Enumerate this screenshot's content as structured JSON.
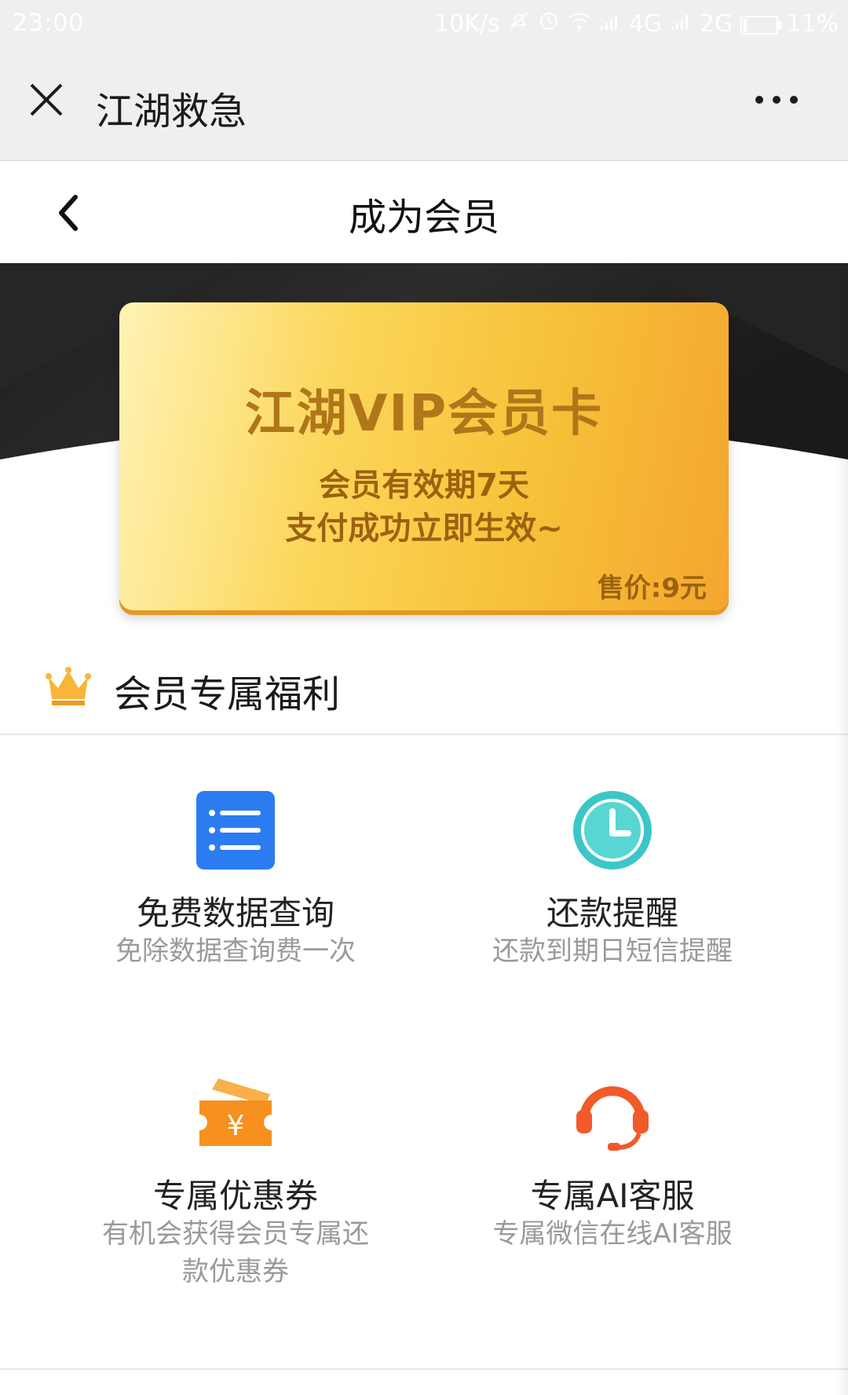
{
  "status_bar": {
    "time": "23:00",
    "net_speed": "10K/s",
    "network1": "4G",
    "network2": "2G",
    "battery": "11%",
    "battery_level": 0.11
  },
  "titlebar": {
    "title": "江湖救急",
    "close_icon": "close-icon",
    "more_icon": "more-icon"
  },
  "navbar": {
    "title": "成为会员",
    "back_icon": "chevron-left-icon"
  },
  "vip_card": {
    "title": "江湖VIP会员卡",
    "line1": "会员有效期7天",
    "line2": "支付成功立即生效~",
    "price": "售价:9元"
  },
  "section": {
    "title": "会员专属福利",
    "icon": "crown-icon"
  },
  "benefits": [
    {
      "title": "免费数据查询",
      "desc": "免除数据查询费一次",
      "icon": "list-icon"
    },
    {
      "title": "还款提醒",
      "desc": "还款到期日短信提醒",
      "icon": "clock-icon"
    },
    {
      "title": "专属优惠券",
      "desc": "有机会获得会员专属还款优惠券",
      "icon": "coupon-icon"
    },
    {
      "title": "专属AI客服",
      "desc": "专属微信在线AI客服",
      "icon": "headset-icon"
    }
  ],
  "colors": {
    "accent_gold": "#f7c33a",
    "card_text": "#9c6210",
    "list_icon_blue": "#2b7cf0",
    "clock_teal": "#3cc6c8",
    "coupon_orange": "#f6901e",
    "headset_red": "#f25a2a"
  }
}
